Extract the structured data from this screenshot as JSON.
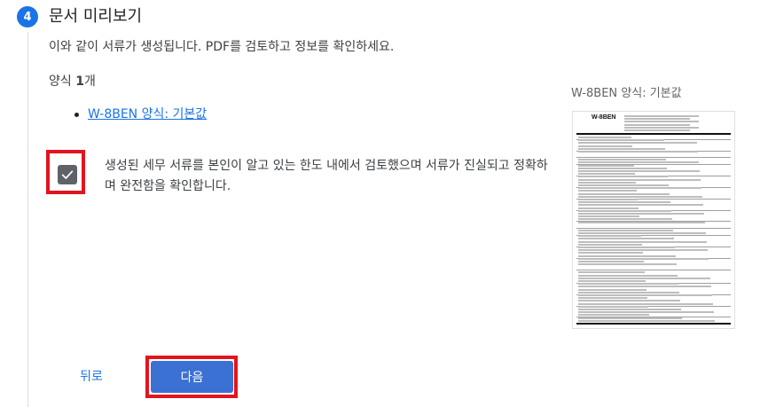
{
  "step": {
    "number": "4",
    "title": "문서 미리보기"
  },
  "intro": "이와 같이 서류가 생성됩니다. PDF를 검토하고 정보를 확인하세요.",
  "documents": {
    "count_prefix": "양식 ",
    "count_value": "1",
    "count_suffix": "개",
    "items": [
      {
        "label": "W-8BEN 양식: 기본값"
      }
    ]
  },
  "confirmation": {
    "checked": true,
    "text": "생성된 세무 서류를 본인이 알고 있는 한도 내에서 검토했으며 서류가 진실되고 정확하며 완전함을 확인합니다."
  },
  "preview": {
    "label": "W-8BEN 양식: 기본값",
    "form_title": "W-8BEN"
  },
  "buttons": {
    "back": "뒤로",
    "next": "다음"
  },
  "colors": {
    "accent": "#1a73e8",
    "primary_button": "#3b71d3",
    "highlight": "#e1151f",
    "checkbox": "#5f6368"
  },
  "icons": {
    "checkbox": "check-icon"
  }
}
